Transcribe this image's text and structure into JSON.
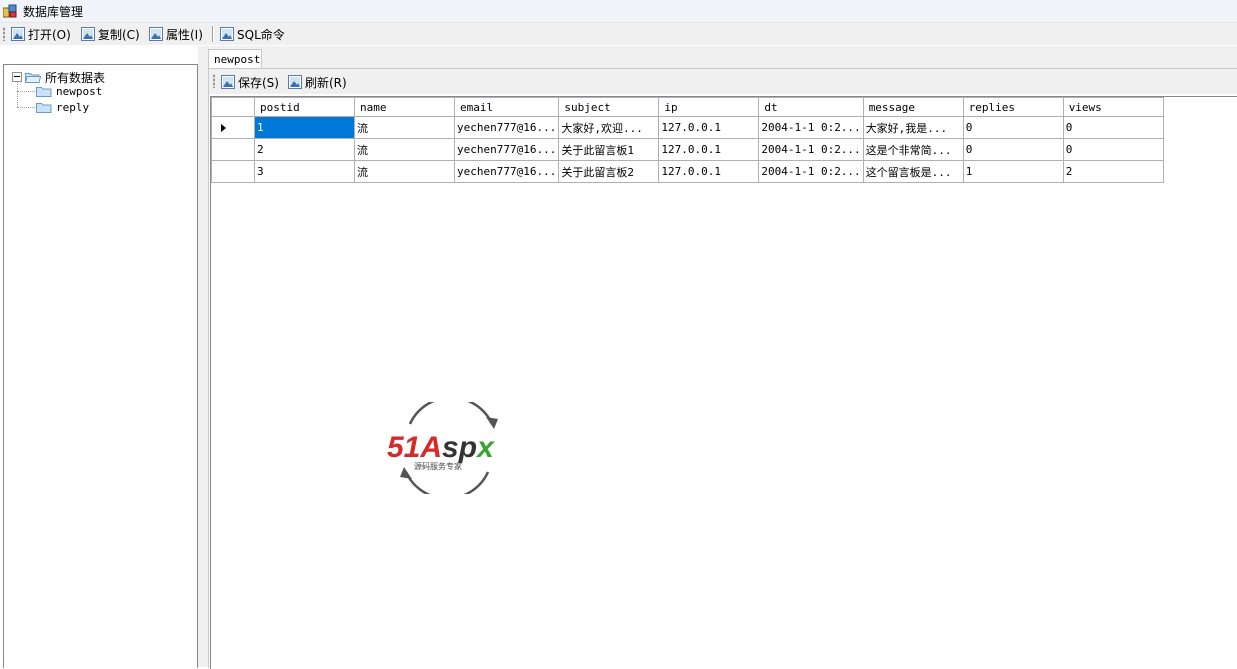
{
  "window": {
    "title": "数据库管理"
  },
  "toolbar": {
    "open_label": "打开(O)",
    "copy_label": "复制(C)",
    "properties_label": "属性(I)",
    "sql_label": "SQL命令"
  },
  "tree": {
    "root_label": "所有数据表",
    "items": [
      "newpost",
      "reply"
    ]
  },
  "tabs": [
    {
      "label": "newpost"
    }
  ],
  "tab_toolbar": {
    "save_label": "保存(S)",
    "refresh_label": "刷新(R)"
  },
  "table": {
    "columns": [
      "postid",
      "name",
      "email",
      "subject",
      "ip",
      "dt",
      "message",
      "replies",
      "views"
    ],
    "rows": [
      [
        "1",
        "流",
        "yechen777@16...",
        "大家好,欢迎...",
        "127.0.0.1",
        "2004-1-1 0:2...",
        "大家好,我是...",
        "0",
        "0"
      ],
      [
        "2",
        "流",
        "yechen777@16...",
        "关于此留言板1",
        "127.0.0.1",
        "2004-1-1 0:2...",
        "这是个非常简...",
        "0",
        "0"
      ],
      [
        "3",
        "流",
        "yechen777@16...",
        "关于此留言板2",
        "127.0.0.1",
        "2004-1-1 0:2...",
        "这个留言板是...",
        "1",
        "2"
      ]
    ],
    "selected_cell": {
      "row": 0,
      "col": 0
    }
  },
  "watermark": {
    "brand": "51Aspx",
    "tagline": "源码服务专家"
  },
  "colors": {
    "selection": "#0078d7",
    "toolbar_bg": "#f0f0f0",
    "brand_red": "#d42a2a",
    "brand_green": "#3aa335"
  }
}
